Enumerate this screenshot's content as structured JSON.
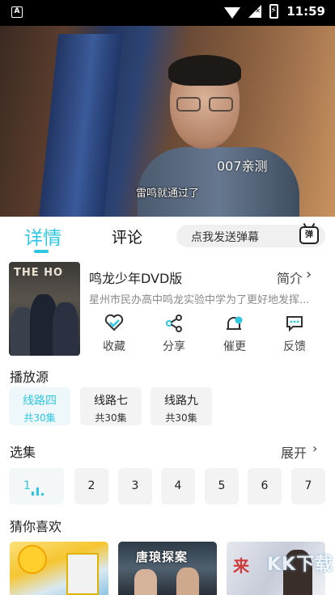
{
  "status_bar": {
    "time": "11:59",
    "app_icon_letter": "A"
  },
  "video": {
    "subtitle": "雷鸣就通过了",
    "overlay_tag": "007亲测",
    "poster_text": "THE HO"
  },
  "tabs": {
    "detail": "详情",
    "comment": "评论",
    "danmu_placeholder": "点我发送弹幕",
    "danmu_icon": "弹"
  },
  "show": {
    "title": "鸣龙少年DVD版",
    "intro_label": "简介",
    "description": "星州市民办高中鸣龙实验中学为了更好地发挥..."
  },
  "actions": [
    {
      "label": "收藏",
      "icon": "heart-icon"
    },
    {
      "label": "分享",
      "icon": "share-icon"
    },
    {
      "label": "催更",
      "icon": "bell-icon"
    },
    {
      "label": "反馈",
      "icon": "feedback-icon"
    }
  ],
  "sources": {
    "label": "播放源",
    "items": [
      {
        "name": "线路四",
        "count": "共30集"
      },
      {
        "name": "线路七",
        "count": "共30集"
      },
      {
        "name": "线路九",
        "count": "共30集"
      }
    ]
  },
  "episodes": {
    "label": "选集",
    "expand_label": "展开",
    "items": [
      "1",
      "2",
      "3",
      "4",
      "5",
      "6",
      "7"
    ]
  },
  "recommend": {
    "label": "猜你喜欢",
    "items": [
      {
        "title": ""
      },
      {
        "title": "唐琅探案"
      },
      {
        "title": "来"
      }
    ],
    "watermark": "KK下载"
  },
  "colors": {
    "accent": "#2ec7e3"
  }
}
